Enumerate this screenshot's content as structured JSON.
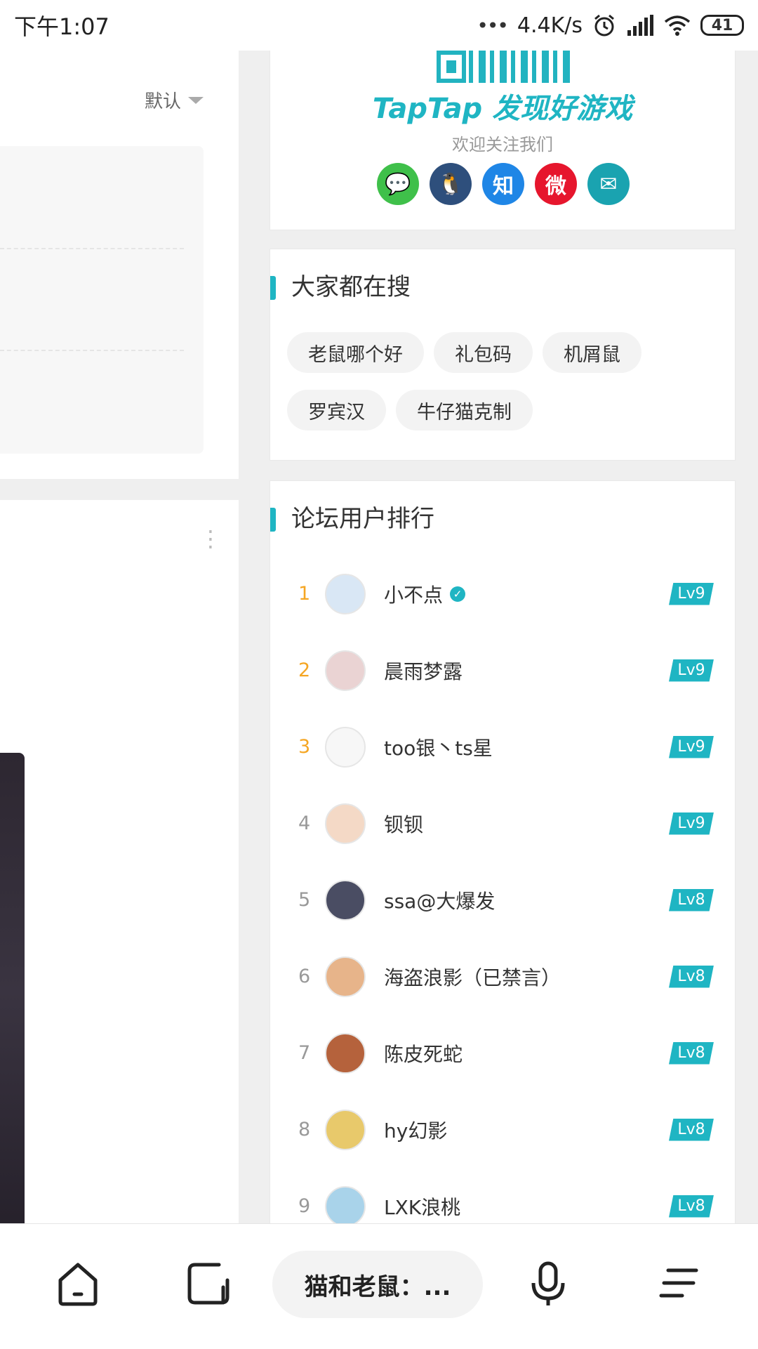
{
  "status_bar": {
    "time": "下午1:07",
    "signal_dots": "•••",
    "speed": "4.4K/s",
    "battery": "41",
    "icons": [
      "alarm-icon",
      "signal-icon",
      "wifi-icon",
      "battery-icon"
    ]
  },
  "left_panel": {
    "sort_label": "默认",
    "more_icon": "kebab-icon"
  },
  "qr_card": {
    "logo_text": "TapTap 发现好游戏",
    "welcome": "欢迎关注我们",
    "socials": [
      {
        "name": "wechat-icon",
        "glyph": "💬",
        "color": "#3fc04a"
      },
      {
        "name": "qq-icon",
        "glyph": "🐧",
        "color": "#2e4f7c"
      },
      {
        "name": "zhihu-icon",
        "glyph": "知",
        "color": "#1f86e6"
      },
      {
        "name": "weibo-icon",
        "glyph": "微",
        "color": "#e6162d"
      },
      {
        "name": "email-icon",
        "glyph": "✉",
        "color": "#1aa3b0"
      }
    ]
  },
  "search_card": {
    "title": "大家都在搜",
    "tags": [
      "老鼠哪个好",
      "礼包码",
      "机屑鼠",
      "罗宾汉",
      "牛仔猫克制"
    ]
  },
  "rank_card": {
    "title": "论坛用户排行",
    "users": [
      {
        "rank": "1",
        "name": "小不点",
        "verified": true,
        "level": "Lv9",
        "avatar_color": "#d9e7f5"
      },
      {
        "rank": "2",
        "name": "晨雨梦露",
        "verified": false,
        "level": "Lv9",
        "avatar_color": "#ead3d3"
      },
      {
        "rank": "3",
        "name": "too银丶ts星",
        "verified": false,
        "level": "Lv9",
        "avatar_color": "#f7f7f7"
      },
      {
        "rank": "4",
        "name": "钡钡",
        "verified": false,
        "level": "Lv9",
        "avatar_color": "#f4d9c6"
      },
      {
        "rank": "5",
        "name": "ssa@大爆发",
        "verified": false,
        "level": "Lv8",
        "avatar_color": "#4a4d63"
      },
      {
        "rank": "6",
        "name": "海盗浪影（已禁言）",
        "verified": false,
        "level": "Lv8",
        "avatar_color": "#e7b48a"
      },
      {
        "rank": "7",
        "name": "陈皮死蛇",
        "verified": false,
        "level": "Lv8",
        "avatar_color": "#b5623c"
      },
      {
        "rank": "8",
        "name": "hy幻影",
        "verified": false,
        "level": "Lv8",
        "avatar_color": "#e8c96b"
      },
      {
        "rank": "9",
        "name": "LXK浪桃",
        "verified": false,
        "level": "Lv8",
        "avatar_color": "#a9d3ea"
      }
    ]
  },
  "bottom_nav": {
    "search_text": "猫和老鼠：...",
    "home_icon": "home-icon",
    "tabs_icon": "tabs-icon",
    "mic_icon": "microphone-icon",
    "menu_icon": "menu-icon"
  },
  "colors": {
    "accent": "#1fb5c3",
    "rank_top": "#f5a623"
  }
}
